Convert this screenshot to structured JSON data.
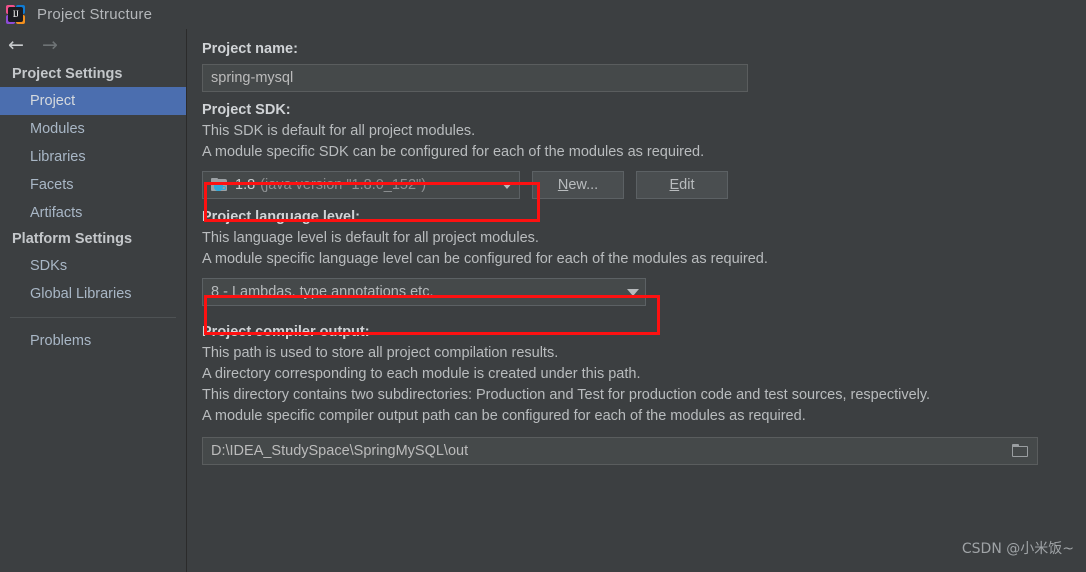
{
  "window": {
    "title": "Project Structure",
    "app_icon": "intellij-idea-logo"
  },
  "toolbar": {
    "back_icon": "arrow-left-icon",
    "back_glyph": "←",
    "forward_icon": "arrow-right-icon",
    "forward_glyph": "→"
  },
  "sidebar": {
    "groups": [
      {
        "label": "Project Settings"
      },
      {
        "label": "Platform Settings"
      }
    ],
    "project_settings_items": [
      {
        "label": "Project",
        "selected": true
      },
      {
        "label": "Modules",
        "selected": false
      },
      {
        "label": "Libraries",
        "selected": false
      },
      {
        "label": "Facets",
        "selected": false
      },
      {
        "label": "Artifacts",
        "selected": false
      }
    ],
    "platform_settings_items": [
      {
        "label": "SDKs",
        "selected": false
      },
      {
        "label": "Global Libraries",
        "selected": false
      }
    ],
    "extra_items": [
      {
        "label": "Problems",
        "selected": false
      }
    ],
    "selection_color": "#4b6eaf"
  },
  "main": {
    "project_name": {
      "label": "Project name:",
      "value": "spring-mysql",
      "placeholder": ""
    },
    "project_sdk": {
      "label": "Project SDK:",
      "description_lines": [
        "This SDK is default for all project modules.",
        "A module specific SDK can be configured for each of the modules as required."
      ],
      "selected_name": "1.8",
      "selected_detail": "(java version \"1.8.0_152\")",
      "icon": "jdk-folder-icon",
      "new_button": {
        "label": "New...",
        "mnemonic": "N"
      },
      "edit_button": {
        "label": "Edit",
        "mnemonic": "E"
      },
      "highlighted": true
    },
    "project_language_level": {
      "label": "Project language level:",
      "description_lines": [
        "This language level is default for all project modules.",
        "A module specific language level can be configured for each of the modules as required."
      ],
      "selected": "8 - Lambdas, type annotations etc.",
      "highlighted": true
    },
    "project_compiler_output": {
      "label": "Project compiler output:",
      "description_lines": [
        "This path is used to store all project compilation results.",
        "A directory corresponding to each module is created under this path.",
        "This directory contains two subdirectories: Production and Test for production code and test sources, respectively.",
        "A module specific compiler output path can be configured for each of the modules as required."
      ],
      "value": "D:\\IDEA_StudySpace\\SpringMySQL\\out",
      "browse_icon": "folder-browse-icon"
    }
  },
  "highlight_color": "#fd1111",
  "watermark": "CSDN @小米饭~"
}
